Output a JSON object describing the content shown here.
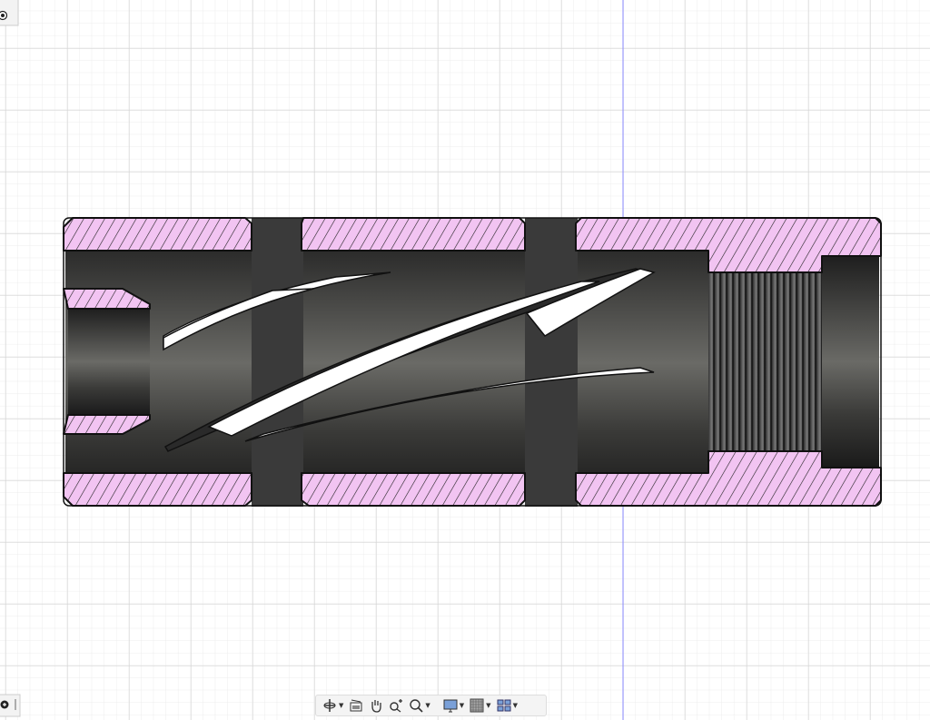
{
  "viewport": {
    "accent_axis_color": "#8a8aff",
    "section_color": "#f0c0f0"
  },
  "toolbar": {
    "items": [
      {
        "icon": "orbit-icon",
        "dropdown": true
      },
      {
        "icon": "look-at-icon",
        "dropdown": false
      },
      {
        "icon": "pan-hand-icon",
        "dropdown": false
      },
      {
        "icon": "zoom-icon",
        "dropdown": false
      },
      {
        "icon": "fit-window-icon",
        "dropdown": true
      },
      {
        "icon": "display-settings-icon",
        "dropdown": true
      },
      {
        "icon": "grid-snap-icon",
        "dropdown": true
      },
      {
        "icon": "viewports-icon",
        "dropdown": true
      }
    ]
  },
  "left_controls": {
    "top_icon": "radio-target-icon",
    "bottom_icon": "add-circle-icon"
  }
}
